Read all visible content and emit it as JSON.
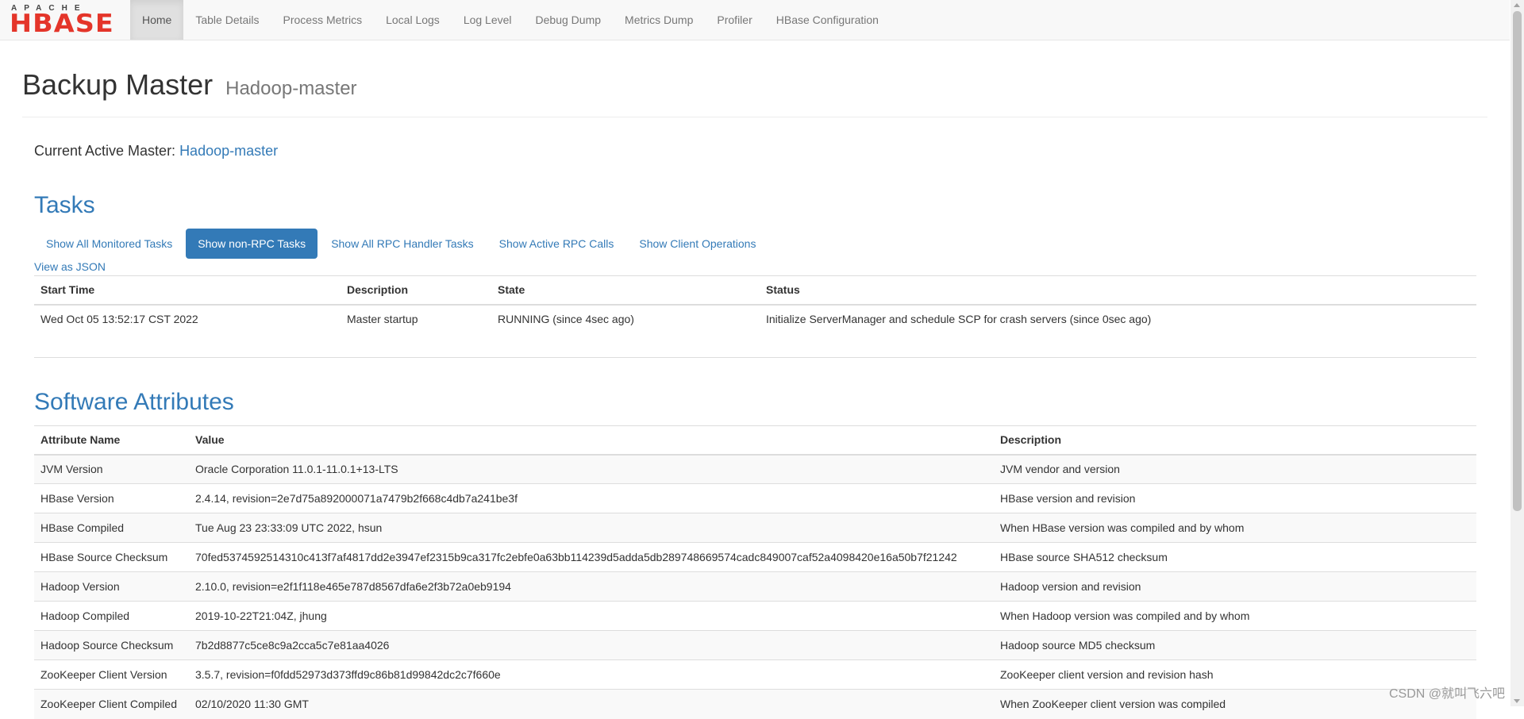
{
  "logo": {
    "top": "APACHE",
    "main": "HBASE"
  },
  "nav": {
    "items": [
      {
        "label": "Home"
      },
      {
        "label": "Table Details"
      },
      {
        "label": "Process Metrics"
      },
      {
        "label": "Local Logs"
      },
      {
        "label": "Log Level"
      },
      {
        "label": "Debug Dump"
      },
      {
        "label": "Metrics Dump"
      },
      {
        "label": "Profiler"
      },
      {
        "label": "HBase Configuration"
      }
    ]
  },
  "header": {
    "title": "Backup Master",
    "subtitle": "Hadoop-master"
  },
  "active_master": {
    "label": "Current Active Master: ",
    "host": "Hadoop-master"
  },
  "tasks": {
    "title": "Tasks",
    "tabs": [
      {
        "label": "Show All Monitored Tasks"
      },
      {
        "label": "Show non-RPC Tasks"
      },
      {
        "label": "Show All RPC Handler Tasks"
      },
      {
        "label": "Show Active RPC Calls"
      },
      {
        "label": "Show Client Operations"
      }
    ],
    "view_json": "View as JSON",
    "columns": [
      "Start Time",
      "Description",
      "State",
      "Status"
    ],
    "rows": [
      [
        "Wed Oct 05 13:52:17 CST 2022",
        "Master startup",
        "RUNNING (since 4sec ago)",
        "Initialize ServerManager and schedule SCP for crash servers (since 0sec ago)"
      ]
    ]
  },
  "software": {
    "title": "Software Attributes",
    "columns": [
      "Attribute Name",
      "Value",
      "Description"
    ],
    "rows": [
      [
        "JVM Version",
        "Oracle Corporation 11.0.1-11.0.1+13-LTS",
        "JVM vendor and version"
      ],
      [
        "HBase Version",
        "2.4.14, revision=2e7d75a892000071a7479b2f668c4db7a241be3f",
        "HBase version and revision"
      ],
      [
        "HBase Compiled",
        "Tue Aug 23 23:33:09 UTC 2022, hsun",
        "When HBase version was compiled and by whom"
      ],
      [
        "HBase Source Checksum",
        "70fed5374592514310c413f7af4817dd2e3947ef2315b9ca317fc2ebfe0a63bb114239d5adda5db289748669574cadc849007caf52a4098420e16a50b7f21242",
        "HBase source SHA512 checksum"
      ],
      [
        "Hadoop Version",
        "2.10.0, revision=e2f1f118e465e787d8567dfa6e2f3b72a0eb9194",
        "Hadoop version and revision"
      ],
      [
        "Hadoop Compiled",
        "2019-10-22T21:04Z, jhung",
        "When Hadoop version was compiled and by whom"
      ],
      [
        "Hadoop Source Checksum",
        "7b2d8877c5ce8c9a2cca5c7e81aa4026",
        "Hadoop source MD5 checksum"
      ],
      [
        "ZooKeeper Client Version",
        "3.5.7, revision=f0fdd52973d373ffd9c86b81d99842dc2c7f660e",
        "ZooKeeper client version and revision hash"
      ],
      [
        "ZooKeeper Client Compiled",
        "02/10/2020 11:30 GMT",
        "When ZooKeeper client version was compiled"
      ]
    ]
  },
  "watermark": "CSDN @就叫飞六吧"
}
